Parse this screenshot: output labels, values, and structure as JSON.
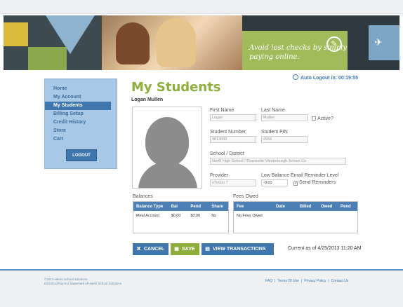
{
  "banner": {
    "tagline": "Avoid lost checks by simply paying online."
  },
  "header": {
    "auto_logout": "Auto Logout in: 00:19:55"
  },
  "sidebar": {
    "items": [
      {
        "label": "Home"
      },
      {
        "label": "My Account"
      },
      {
        "label": "My Students"
      },
      {
        "label": "Billing Setup"
      },
      {
        "label": "Credit History"
      },
      {
        "label": "Store"
      },
      {
        "label": "Cart"
      }
    ],
    "active_index": 2,
    "logout_label": "LOGOUT"
  },
  "main": {
    "title": "My Students",
    "student_name": "Logan Mullen",
    "fields": {
      "first_name": {
        "label": "First Name",
        "value": "Logan"
      },
      "last_name": {
        "label": "Last Name",
        "value": "Mullen"
      },
      "active": {
        "label": "Active?",
        "checked": false
      },
      "student_number": {
        "label": "Student Number",
        "value": "3813093"
      },
      "student_pin": {
        "label": "Student PIN",
        "value": "2656"
      },
      "school_district": {
        "label": "School / District",
        "value": "North High School / Evansville-Vanderburgh School Co"
      },
      "provider": {
        "label": "Provider",
        "value": "eTrition 7"
      },
      "low_balance": {
        "label": "Low Balance Email Reminder Level",
        "value": "-0.01"
      },
      "send_reminders": {
        "label": "Send Reminders",
        "checked": true
      }
    },
    "balances": {
      "label": "Balances",
      "columns": [
        "Balance Type",
        "Bal",
        "Pend",
        "Share"
      ],
      "rows": [
        [
          "Meal Account",
          "$0.00",
          "$0.00",
          "No"
        ]
      ]
    },
    "fees_owed": {
      "label": "Fees Owed",
      "columns": [
        "Fee",
        "Date",
        "Billed",
        "Owed",
        "Pend"
      ],
      "empty_text": "No Fees Owed"
    },
    "buttons": {
      "cancel": "CANCEL",
      "save": "SAVE",
      "view_transactions": "VIEW TRANSACTIONS"
    },
    "current_as_of": "Current as of 4/25/2013 11:20 AM"
  },
  "footer": {
    "copyright_line1": "©2013 Harris School Solutions.",
    "copyright_line2": "EZSchoolPay is a trademark of Harris School Solutions.",
    "links": [
      "FAQ",
      "Terms Of Use",
      "Privacy Policy",
      "Contact Us"
    ]
  },
  "colors": {
    "accent_blue": "#3f76ae",
    "accent_green": "#8eae3b",
    "sidebar_bg": "#a9c8e6"
  }
}
